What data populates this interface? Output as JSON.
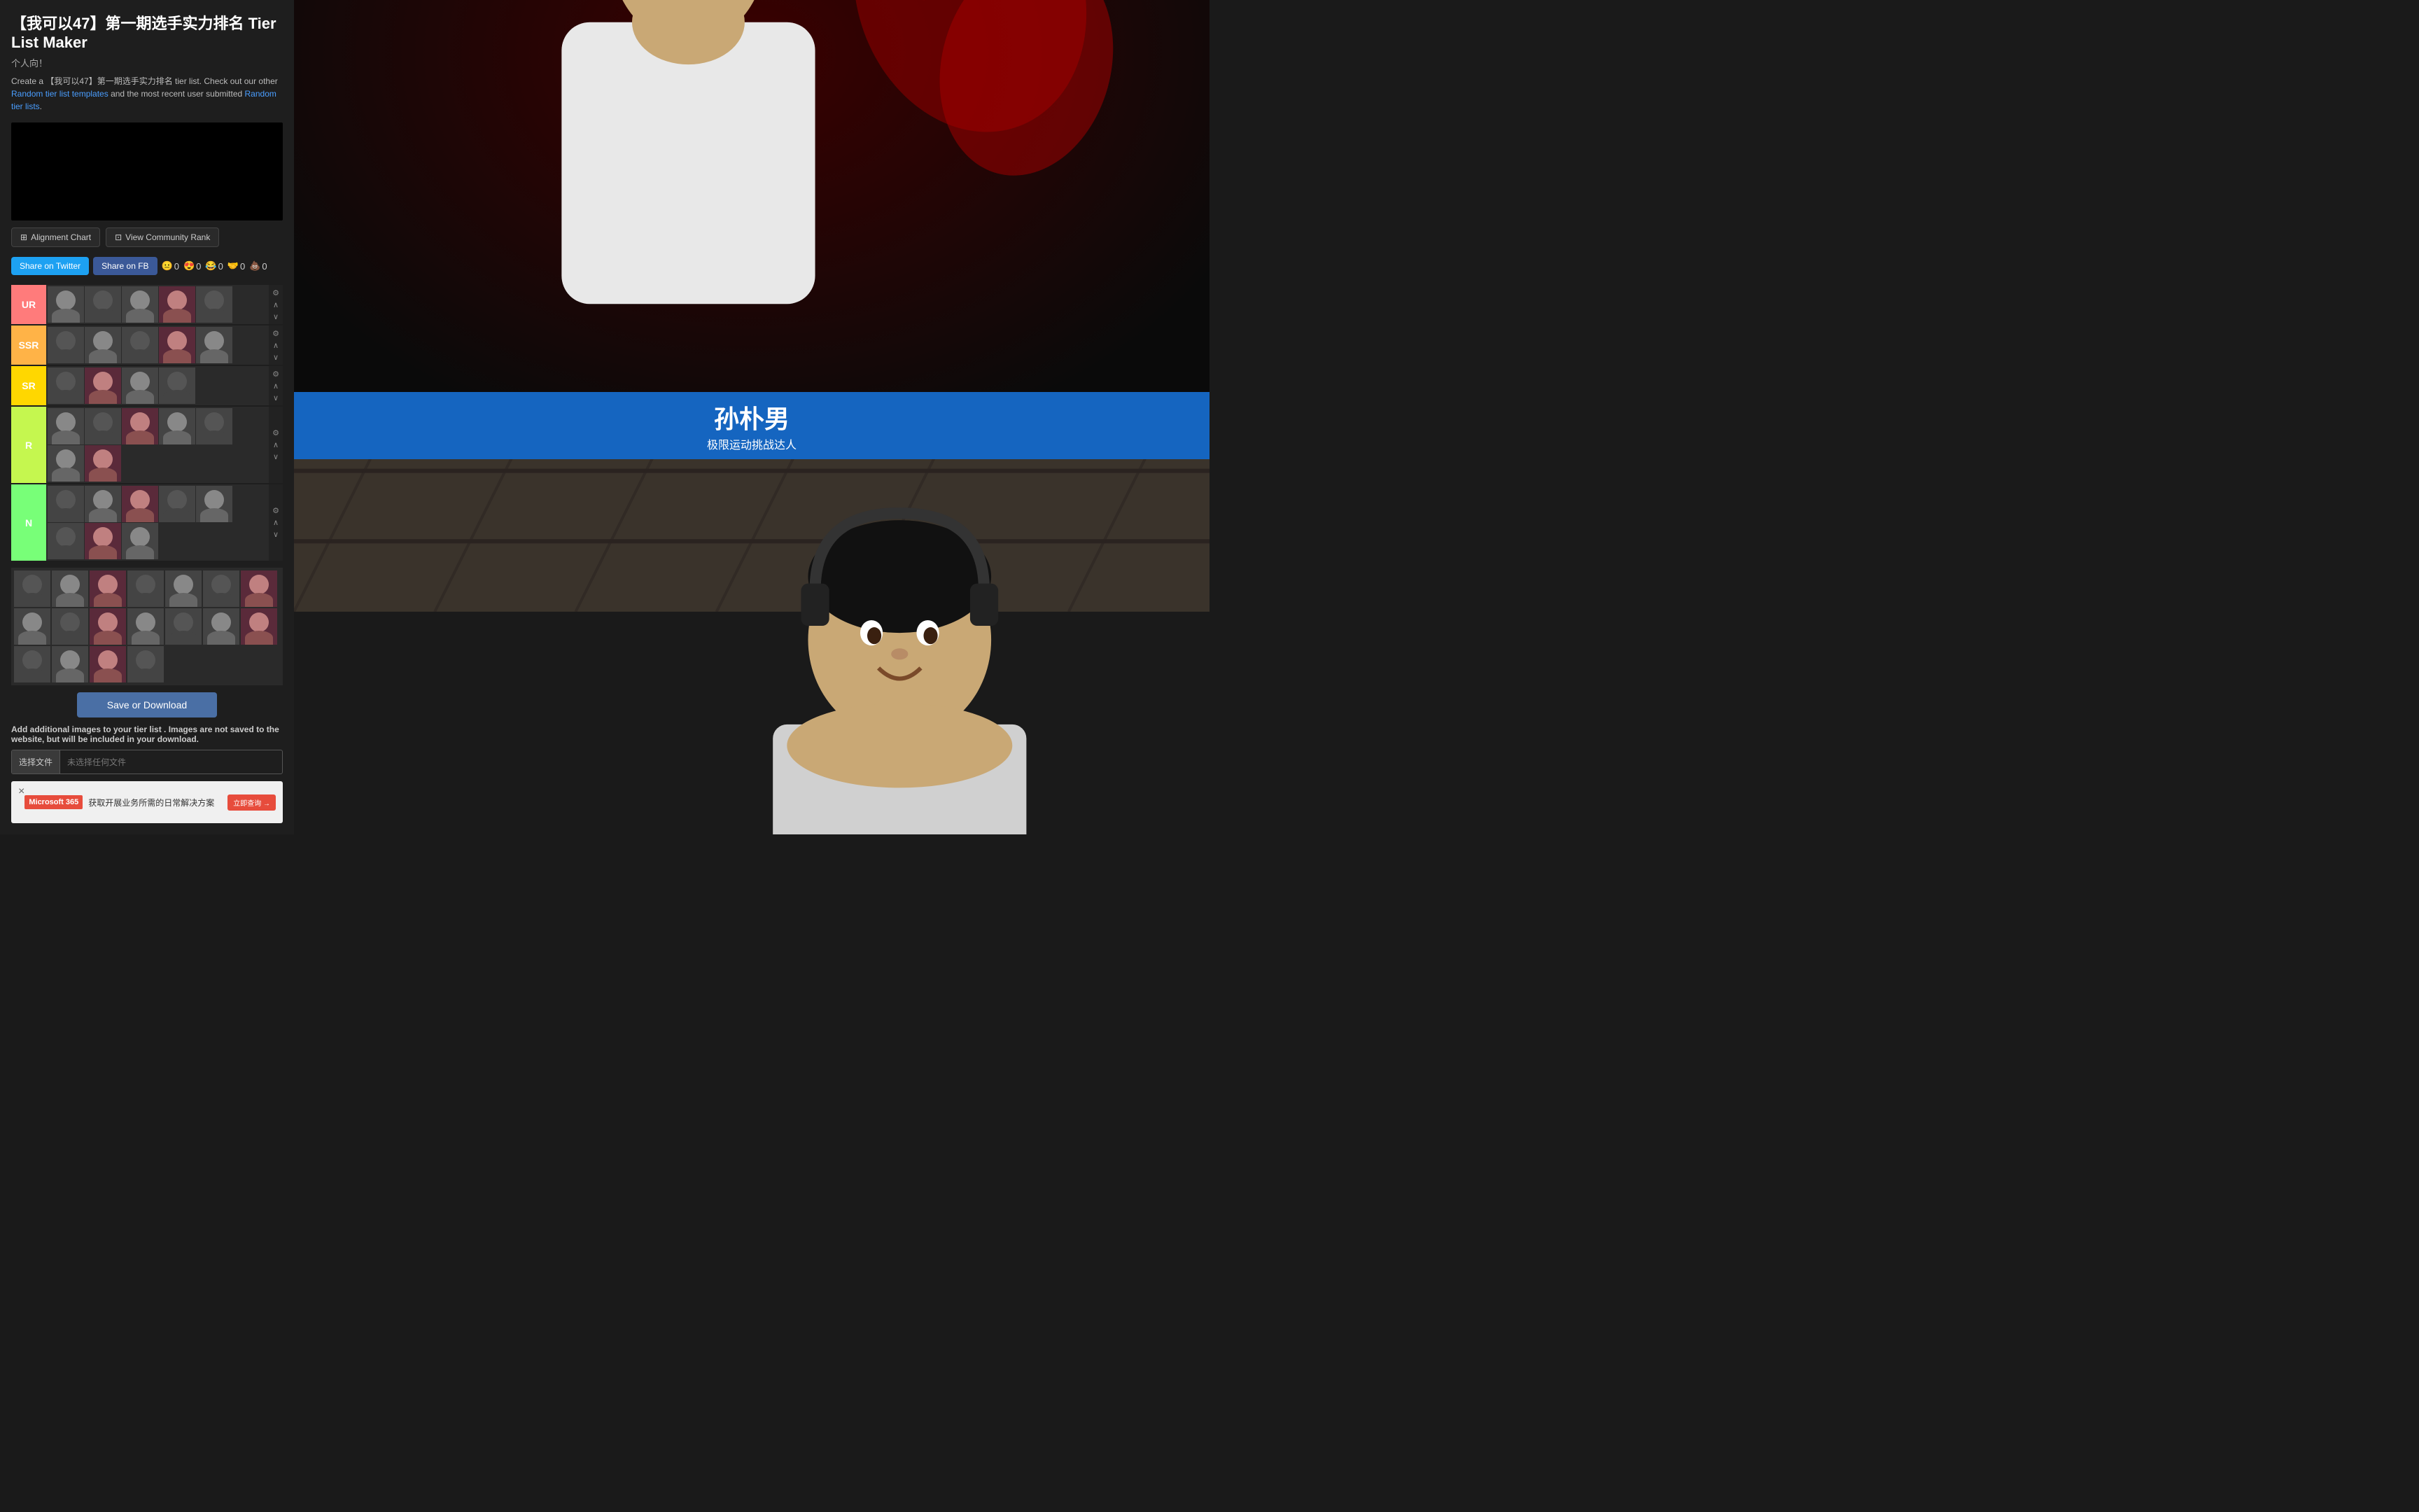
{
  "page": {
    "title": "【我可以47】第一期选手实力排名 Tier List Maker",
    "subtitle": "个人向！",
    "description_part1": "Create a 【我可以47】第一期选手实力排名 tier list. Check out our other ",
    "link1": "Random tier list templates",
    "description_part2": " and the most recent user submitted ",
    "link2": "Random tier lists",
    "description_end": "."
  },
  "buttons": {
    "alignment_chart": "Alignment Chart",
    "view_community_rank": "View Community Rank",
    "share_twitter": "Share on Twitter",
    "share_fb": "Share on FB",
    "save_download": "Save or Download",
    "choose_file": "选择文件",
    "no_file": "未选择任何文件",
    "ad_close": "×",
    "ad_cta": "立即查询 →"
  },
  "reactions": {
    "neutral_count": "0",
    "love_count": "0",
    "laugh_count": "0",
    "hug_count": "0",
    "poop_count": "0"
  },
  "tiers": [
    {
      "label": "UR",
      "color": "#ff7b7b",
      "image_count": 5
    },
    {
      "label": "SSR",
      "color": "#ffb347",
      "image_count": 5
    },
    {
      "label": "SR",
      "color": "#ffd700",
      "image_count": 4
    },
    {
      "label": "R",
      "color": "#c5f74f",
      "image_count": 7
    },
    {
      "label": "N",
      "color": "#78ff78",
      "image_count": 8
    }
  ],
  "pool": {
    "image_count_row1": 14,
    "image_count_row2": 4
  },
  "add_images": {
    "label": "Add additional images to your tier list",
    "description": ". Images are not saved to the website, but will be included in your download."
  },
  "ad": {
    "brand": "Microsoft 365",
    "text": "获取开展业务所需的日常解决方案",
    "logo_text": "M365"
  },
  "contestant": {
    "name": "孙朴男",
    "tag": "极限运动挑战达人"
  },
  "icons": {
    "grid": "⊞",
    "community": "⊡",
    "gear": "⚙",
    "up": "∧",
    "down": "∨",
    "menu": "⋮"
  }
}
